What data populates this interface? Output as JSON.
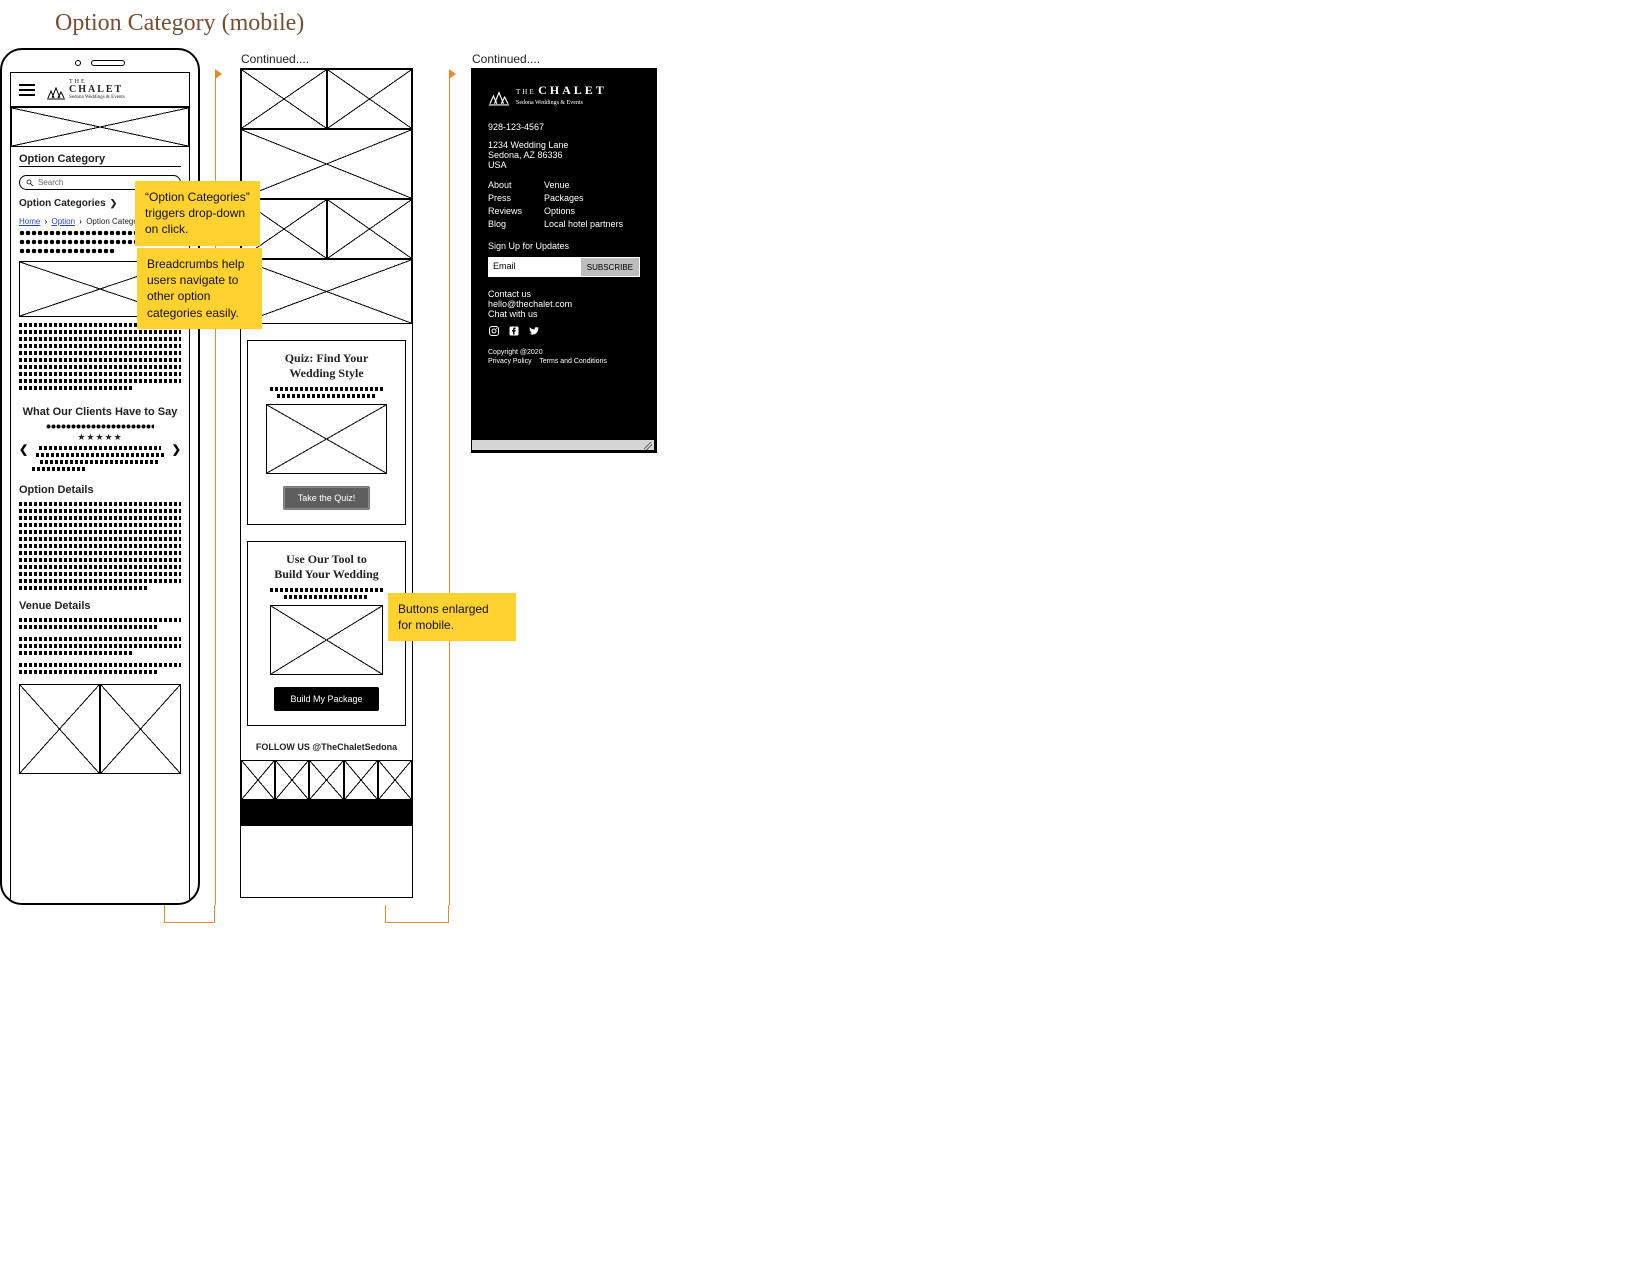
{
  "page": {
    "title": "Option Category (mobile)"
  },
  "labels": {
    "continued_1": "Continued....",
    "continued_2": "Continued...."
  },
  "brand": {
    "the": "THE",
    "name": "CHALET",
    "sub": "Sedona Weddings & Events"
  },
  "s1": {
    "hero_title": "Option Category",
    "search_placeholder": "Search",
    "option_categories_label": "Option Categories",
    "breadcrumbs": {
      "home": "Home",
      "option": "Option",
      "current": "Option Category"
    },
    "testimonials_heading": "What Our Clients Have to Say",
    "option_details_heading": "Option Details",
    "venue_details_heading": "Venue Details"
  },
  "s2": {
    "quiz_title_l1": "Quiz: Find Your",
    "quiz_title_l2": "Wedding Style",
    "quiz_cta": "Take the Quiz!",
    "tool_title_l1": "Use Our Tool to",
    "tool_title_l2": "Build Your Wedding",
    "tool_cta": "Build My Package",
    "follow": "FOLLOW US @TheChaletSedona"
  },
  "footer": {
    "phone": "928-123-4567",
    "addr_l1": "1234 Wedding Lane",
    "addr_l2": "Sedona, AZ 86336",
    "addr_l3": "USA",
    "links_left": [
      "About",
      "Press",
      "Reviews",
      "Blog"
    ],
    "links_right": [
      "Venue",
      "Packages",
      "Options",
      "Local hotel partners"
    ],
    "signup_heading": "Sign Up for Updates",
    "email_placeholder": "Email",
    "subscribe": "SUBSCRIBE",
    "contact_us": "Contact us",
    "email": "hello@thechalet.com",
    "chat": "Chat with us",
    "copyright": "Copyright @2020",
    "privacy": "Privacy Policy",
    "terms": "Terms and Conditions"
  },
  "notes": {
    "n1": "“Option Categories” triggers drop-down on click.",
    "n2": "Breadcrumbs help users navigate to other option categories easily.",
    "n3": "Buttons enlarged for mobile."
  }
}
